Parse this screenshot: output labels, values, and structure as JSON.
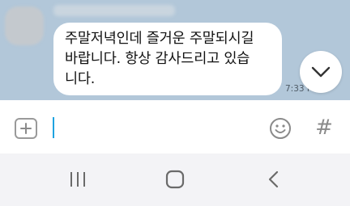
{
  "chat": {
    "message_text": "주말저녁인데 즐거운 주말되시길\n바랍니다. 항상 감사드리고 있습\n니다.",
    "timestamp": "7:33 PM"
  },
  "icons": {
    "scroll_down": "chevron-down-icon",
    "attach": "plus-icon",
    "emoji": "emoji-icon",
    "hashtag": "#",
    "nav_recents": "recents-icon",
    "nav_home": "home-icon",
    "nav_back": "back-icon"
  },
  "colors": {
    "chat_background": "#b2c7d9",
    "bubble": "#ffffff",
    "cursor": "#1fa3e0"
  }
}
